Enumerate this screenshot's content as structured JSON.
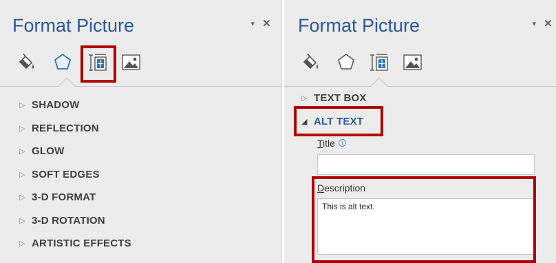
{
  "left_panel": {
    "title": "Format Picture",
    "dropdown_glyph": "▾",
    "close_glyph": "×",
    "tabs": [
      {
        "icon": "fill-line-icon",
        "selected": false
      },
      {
        "icon": "effects-pentagon-icon",
        "selected": true
      },
      {
        "icon": "size-properties-icon",
        "selected": false,
        "highlighted": true
      },
      {
        "icon": "picture-icon",
        "selected": false
      }
    ],
    "sections": [
      {
        "label": "SHADOW"
      },
      {
        "label": "REFLECTION"
      },
      {
        "label": "GLOW"
      },
      {
        "label": "SOFT EDGES"
      },
      {
        "label": "3-D FORMAT"
      },
      {
        "label": "3-D ROTATION"
      },
      {
        "label": "ARTISTIC EFFECTS"
      }
    ],
    "collapsed_glyph": "▷"
  },
  "right_panel": {
    "title": "Format Picture",
    "dropdown_glyph": "▾",
    "close_glyph": "×",
    "tabs": [
      {
        "icon": "fill-line-icon",
        "selected": false
      },
      {
        "icon": "effects-pentagon-icon",
        "selected": false
      },
      {
        "icon": "size-properties-icon",
        "selected": true
      },
      {
        "icon": "picture-icon",
        "selected": false
      }
    ],
    "text_box_label": "TEXT BOX",
    "alt_text_label": "ALT TEXT",
    "collapsed_glyph": "▷",
    "expanded_glyph": "◢",
    "title_label_accel": "T",
    "title_label_rest": "itle",
    "info_glyph": "i",
    "title_value": "",
    "description_label_accel": "D",
    "description_label_rest": "escription",
    "description_value": "This is alt text."
  },
  "colors": {
    "accent": "#2b579a",
    "highlight": "#b10000",
    "pane_bg": "#ececec",
    "selected_tab_icon": "#2e75b6"
  }
}
